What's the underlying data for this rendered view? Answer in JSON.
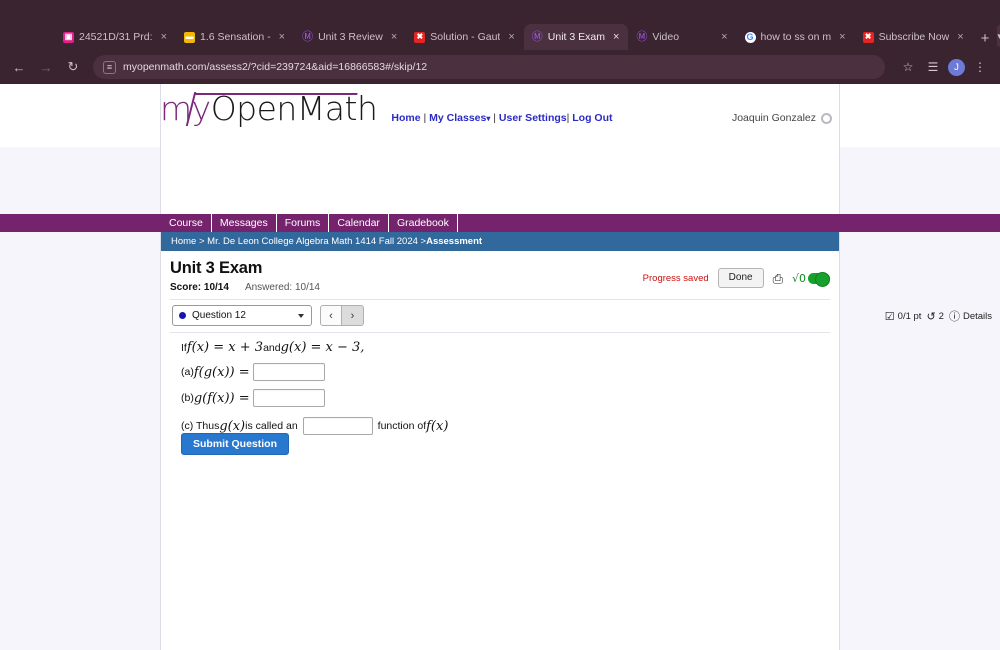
{
  "browser": {
    "tabs": [
      {
        "title": "24521D/31 Prd:",
        "favicon": "image-icon",
        "favicon_class": "fav-pink",
        "favicon_glyph": "▣",
        "active": false
      },
      {
        "title": "1.6 Sensation -",
        "favicon": "note-icon",
        "favicon_class": "fav-yellow",
        "favicon_glyph": "▬",
        "active": false
      },
      {
        "title": "Unit 3 Review",
        "favicon": "mathjax-icon",
        "favicon_class": "fav-mathjax",
        "favicon_glyph": "Ⓜ",
        "active": false
      },
      {
        "title": "Solution - Gaut",
        "favicon": "gauth-icon",
        "favicon_class": "fav-red",
        "favicon_glyph": "✖",
        "active": false
      },
      {
        "title": "Unit 3 Exam",
        "favicon": "mathjax-icon",
        "favicon_class": "fav-mathjax",
        "favicon_glyph": "Ⓜ",
        "active": true
      },
      {
        "title": "Video",
        "favicon": "mathjax-icon",
        "favicon_class": "fav-mathjax",
        "favicon_glyph": "Ⓜ",
        "active": false
      },
      {
        "title": "how to ss on m",
        "favicon": "google-icon",
        "favicon_class": "fav-google",
        "favicon_glyph": "G",
        "active": false
      },
      {
        "title": "Subscribe Now",
        "favicon": "gauth-icon",
        "favicon_class": "fav-red",
        "favicon_glyph": "✖",
        "active": false
      }
    ],
    "close_glyph": "×",
    "new_tab_glyph": "+",
    "tab_list_glyph": "▾",
    "back_glyph": "←",
    "forward_glyph": "→",
    "reload_glyph": "↻",
    "site_info_glyph": "≡",
    "url": "myopenmath.com/assess2/?cid=239724&aid=16866583#/skip/12",
    "bookmark_glyph": "☆",
    "extensions_glyph": "☰",
    "profile_initial": "J",
    "menu_glyph": "⋮"
  },
  "site": {
    "logo_my": "my",
    "logo_open": "OpenMath",
    "nav_links": [
      "Home",
      "My Classes",
      "User Settings",
      "Log Out"
    ],
    "nav_caret": "▾",
    "user_name": "Joaquin Gonzalez",
    "tabs": [
      "Course",
      "Messages",
      "Forums",
      "Calendar",
      "Gradebook"
    ],
    "breadcrumb_prefix": "Home > Mr. De Leon College Algebra Math 1414 Fall 2024 > ",
    "breadcrumb_current": "Assessment"
  },
  "assessment": {
    "title": "Unit 3 Exam",
    "score_label": "Score:",
    "score_value": "10/14",
    "answered_label": "Answered:",
    "answered_value": "10/14",
    "progress_saved": "Progress saved",
    "done_label": "Done",
    "print_glyph": "⎙",
    "sqrt_glyph": "√0",
    "toggle_state": "on",
    "toggle_color": "#16a02c"
  },
  "qnav": {
    "selected_question": "Question 12",
    "dot_color": "#1616b0",
    "prev_glyph": "‹",
    "next_glyph": "›",
    "points_glyph": "☑",
    "points_text": "0/1 pt",
    "attempts_glyph": "↺",
    "attempts_text": "2",
    "details_glyph": "ⓘ",
    "details_text": "Details"
  },
  "question": {
    "prompt_prefix": "If ",
    "prompt_f": "f(x) = x + 3",
    "prompt_and": " and ",
    "prompt_g": "g(x) = x − 3,",
    "part_a_label": "(a) ",
    "part_a_math": "f(g(x)) =",
    "part_a_value": "",
    "part_a_placeholder": "",
    "part_b_label": "(b) ",
    "part_b_math": "g(f(x)) =",
    "part_b_value": "",
    "part_b_placeholder": "",
    "part_c_prefix": "(c) Thus ",
    "part_c_g": "g(x)",
    "part_c_mid": " is called an",
    "part_c_value": "",
    "part_c_placeholder": "",
    "part_c_suffix": "function of ",
    "part_c_f": "f(x)",
    "submit_label": "Submit Question"
  }
}
